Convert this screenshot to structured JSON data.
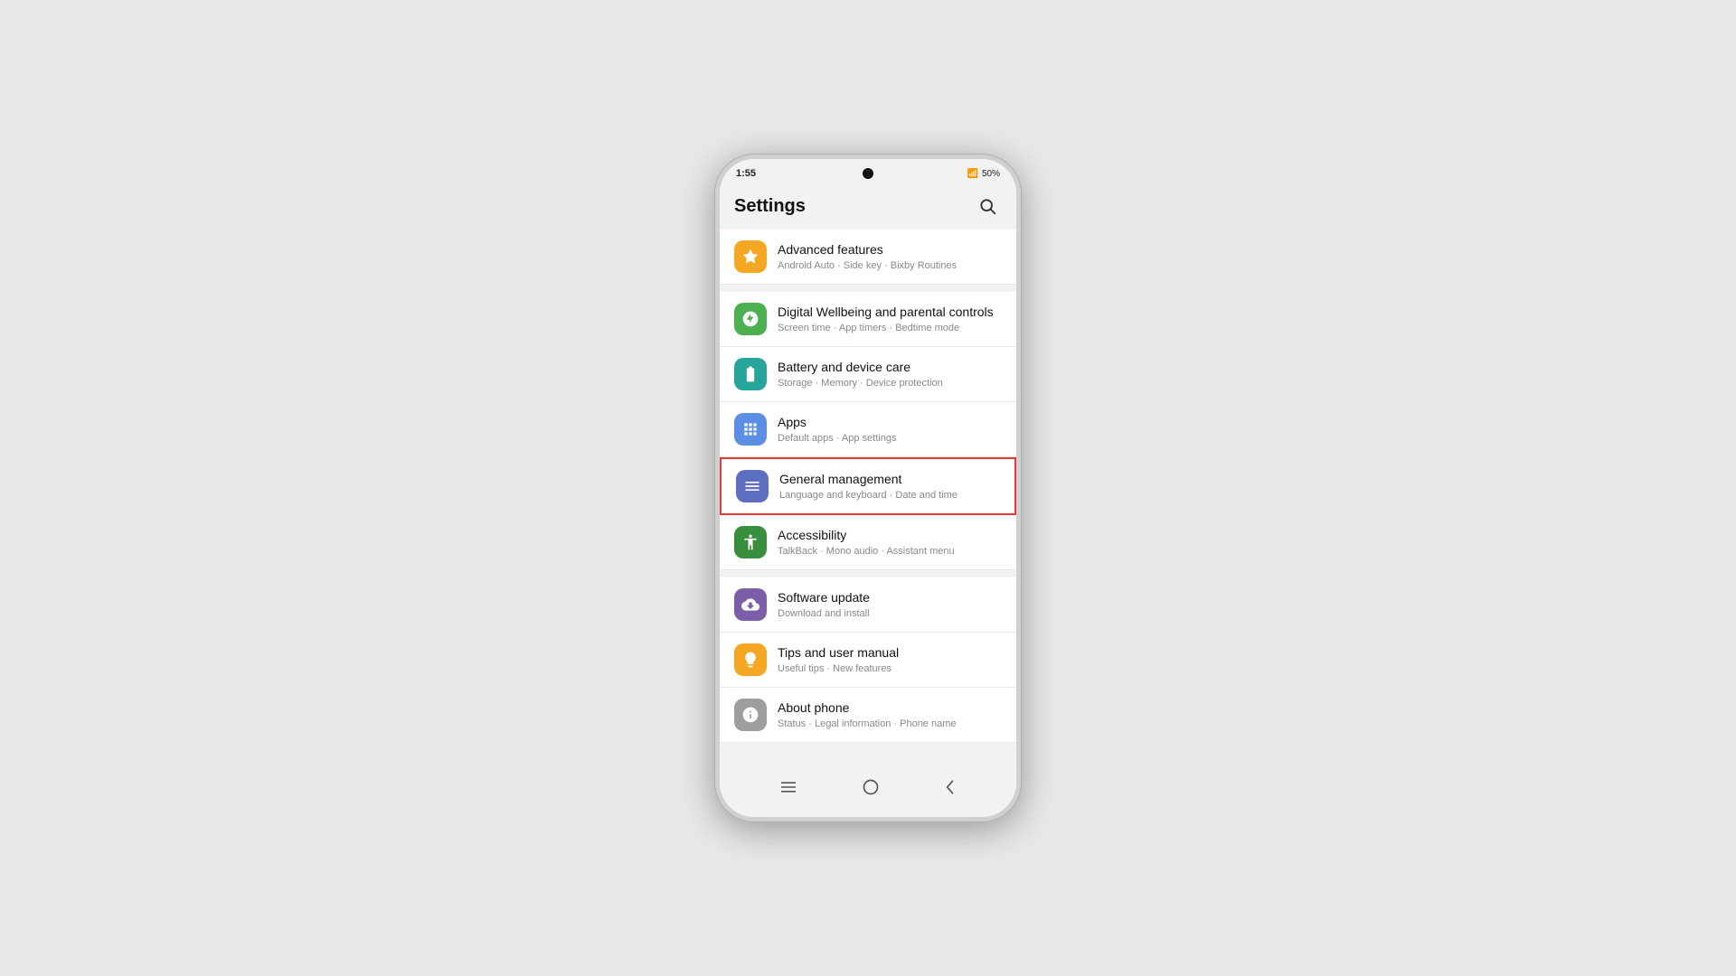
{
  "status": {
    "time": "1:55",
    "battery": "50%",
    "signal": "WiFi"
  },
  "header": {
    "title": "Settings",
    "search_label": "Search"
  },
  "items": [
    {
      "id": "advanced-features",
      "icon_type": "icon-orange",
      "icon_char": "★",
      "title": "Advanced features",
      "subtitle": "Android Auto · Side key · Bixby Routines",
      "highlighted": false
    },
    {
      "id": "digital-wellbeing",
      "icon_type": "icon-green-bright",
      "icon_char": "◑",
      "title": "Digital Wellbeing and parental controls",
      "subtitle": "Screen time · App timers · Bedtime mode",
      "highlighted": false
    },
    {
      "id": "battery-care",
      "icon_type": "icon-teal",
      "icon_char": "⊕",
      "title": "Battery and device care",
      "subtitle": "Storage · Memory · Device protection",
      "highlighted": false
    },
    {
      "id": "apps",
      "icon_type": "icon-blue-light",
      "icon_char": "⊞",
      "title": "Apps",
      "subtitle": "Default apps · App settings",
      "highlighted": false
    },
    {
      "id": "general-management",
      "icon_type": "icon-blue-slate",
      "icon_char": "≡",
      "title": "General management",
      "subtitle": "Language and keyboard · Date and time",
      "highlighted": true
    },
    {
      "id": "accessibility",
      "icon_type": "icon-green-dark",
      "icon_char": "♿",
      "title": "Accessibility",
      "subtitle": "TalkBack · Mono audio · Assistant menu",
      "highlighted": false
    },
    {
      "id": "software-update",
      "icon_type": "icon-purple",
      "icon_char": "↓",
      "title": "Software update",
      "subtitle": "Download and install",
      "highlighted": false
    },
    {
      "id": "tips",
      "icon_type": "icon-orange2",
      "icon_char": "💡",
      "title": "Tips and user manual",
      "subtitle": "Useful tips · New features",
      "highlighted": false
    },
    {
      "id": "about-phone",
      "icon_type": "icon-gray",
      "icon_char": "ℹ",
      "title": "About phone",
      "subtitle": "Status · Legal information · Phone name",
      "highlighted": false
    }
  ],
  "bottom_nav": {
    "recents": "|||",
    "home": "○",
    "back": "‹"
  }
}
